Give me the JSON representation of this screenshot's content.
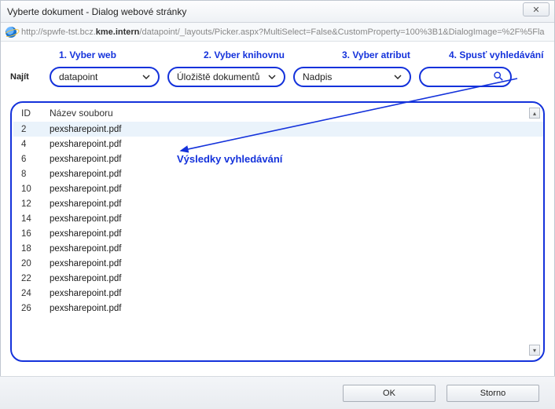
{
  "window": {
    "title": "Vyberte dokument - Dialog webové stránky",
    "close_glyph": "✕"
  },
  "address": {
    "prefix": "http://spwfe-tst.bcz.",
    "host": "kme.intern",
    "suffix": "/datapoint/_layouts/Picker.aspx?MultiSelect=False&CustomProperty=100%3B1&DialogImage=%2F%5Fla"
  },
  "steps": {
    "s1": "1. Vyber web",
    "s2": "2. Vyber knihovnu",
    "s3": "3. Vyber atribut",
    "s4": "4. Spusť vyhledávání"
  },
  "labels": {
    "najit": "Najít",
    "results": "Výsledky vyhledávání"
  },
  "combos": {
    "web": "datapoint",
    "library": "Úložiště dokumentů",
    "attribute": "Nadpis"
  },
  "search": {
    "value": ""
  },
  "table": {
    "headers": {
      "id": "ID",
      "name": "Název souboru"
    },
    "rows": [
      {
        "id": "2",
        "name": "pexsharepoint.pdf",
        "selected": true
      },
      {
        "id": "4",
        "name": "pexsharepoint.pdf"
      },
      {
        "id": "6",
        "name": "pexsharepoint.pdf"
      },
      {
        "id": "8",
        "name": "pexsharepoint.pdf"
      },
      {
        "id": "10",
        "name": "pexsharepoint.pdf"
      },
      {
        "id": "12",
        "name": "pexsharepoint.pdf"
      },
      {
        "id": "14",
        "name": "pexsharepoint.pdf"
      },
      {
        "id": "16",
        "name": "pexsharepoint.pdf"
      },
      {
        "id": "18",
        "name": "pexsharepoint.pdf"
      },
      {
        "id": "20",
        "name": "pexsharepoint.pdf"
      },
      {
        "id": "22",
        "name": "pexsharepoint.pdf"
      },
      {
        "id": "24",
        "name": "pexsharepoint.pdf"
      },
      {
        "id": "26",
        "name": "pexsharepoint.pdf"
      }
    ]
  },
  "footer": {
    "ok": "OK",
    "cancel": "Storno"
  }
}
